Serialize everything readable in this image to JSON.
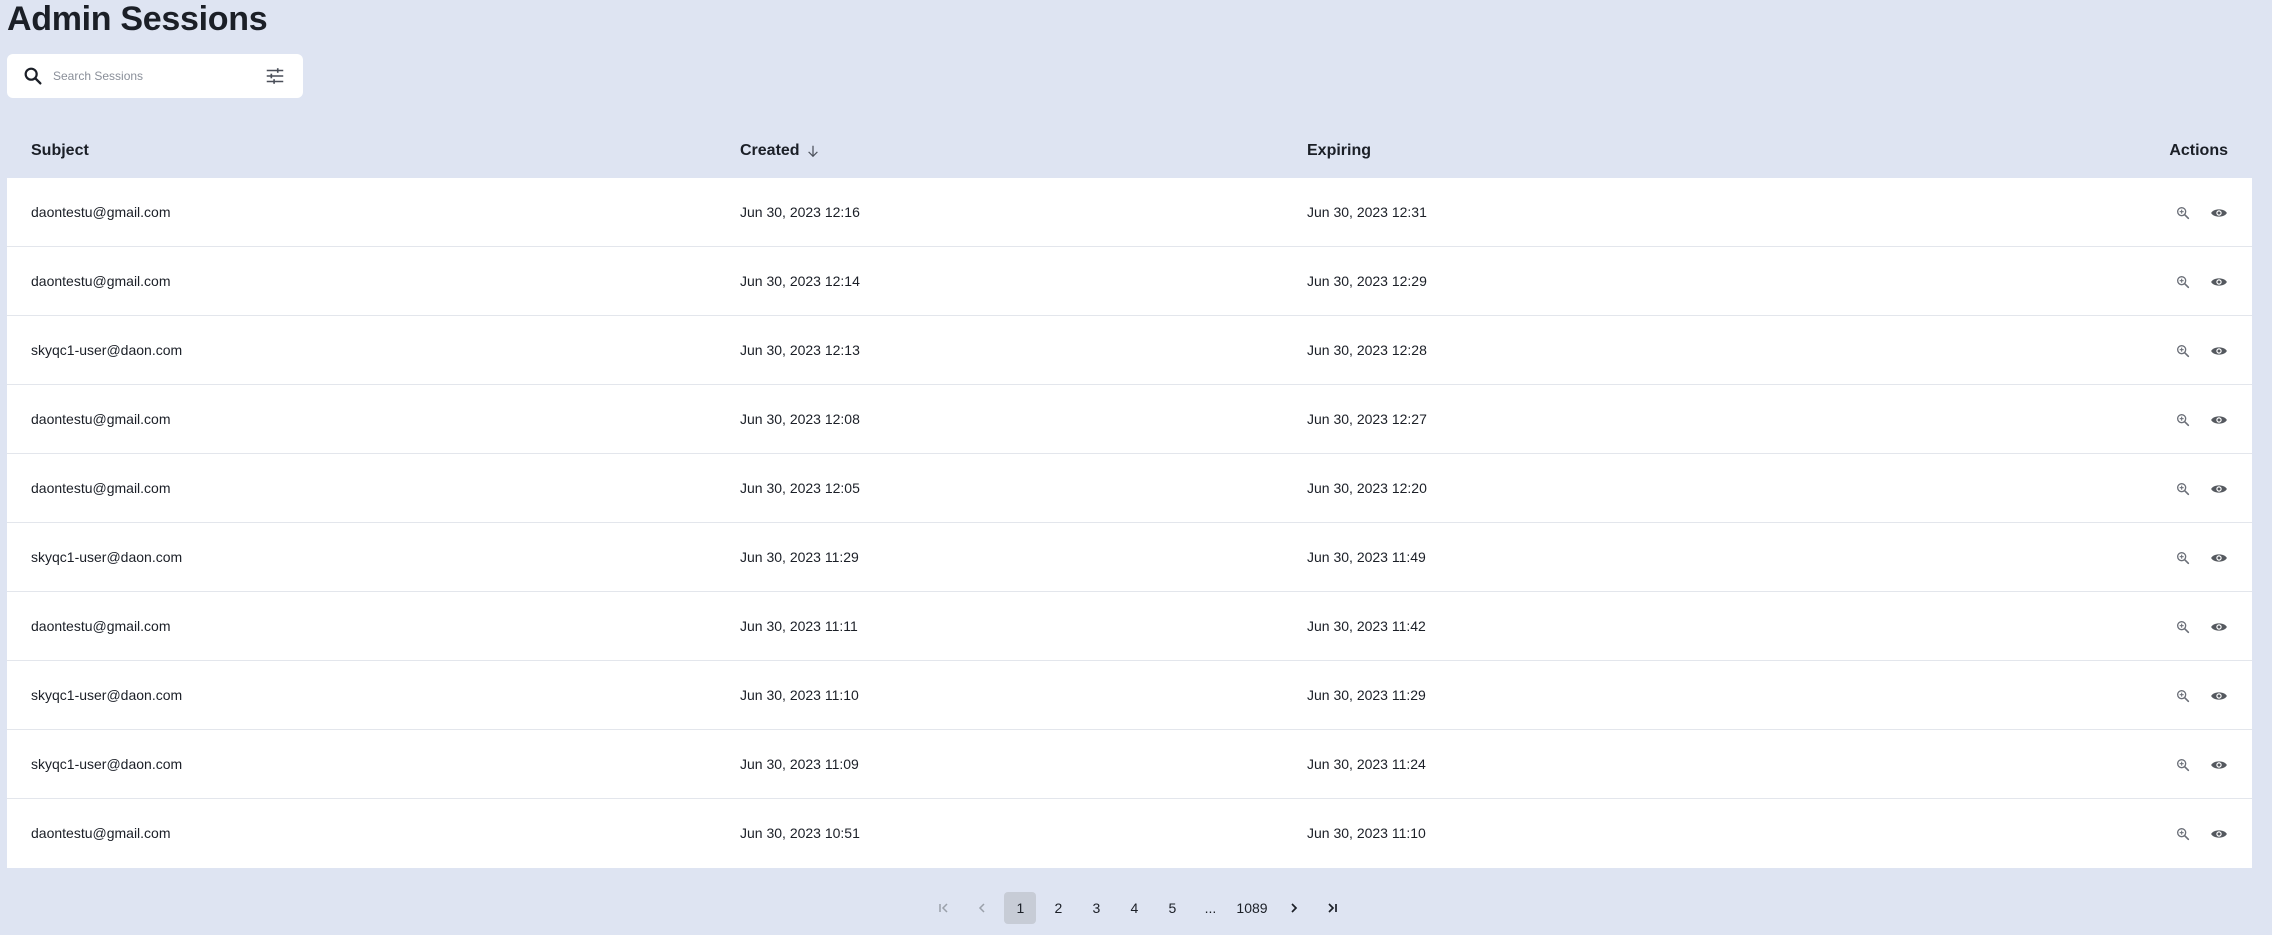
{
  "page": {
    "title": "Admin Sessions"
  },
  "search": {
    "placeholder": "Search Sessions",
    "value": ""
  },
  "table": {
    "columns": {
      "subject": "Subject",
      "created": "Created",
      "expiring": "Expiring",
      "actions": "Actions"
    },
    "rows": [
      {
        "subject": "daontestu@gmail.com",
        "created": "Jun 30, 2023 12:16",
        "expiring": "Jun 30, 2023 12:31"
      },
      {
        "subject": "daontestu@gmail.com",
        "created": "Jun 30, 2023 12:14",
        "expiring": "Jun 30, 2023 12:29"
      },
      {
        "subject": "skyqc1-user@daon.com",
        "created": "Jun 30, 2023 12:13",
        "expiring": "Jun 30, 2023 12:28"
      },
      {
        "subject": "daontestu@gmail.com",
        "created": "Jun 30, 2023 12:08",
        "expiring": "Jun 30, 2023 12:27"
      },
      {
        "subject": "daontestu@gmail.com",
        "created": "Jun 30, 2023 12:05",
        "expiring": "Jun 30, 2023 12:20"
      },
      {
        "subject": "skyqc1-user@daon.com",
        "created": "Jun 30, 2023 11:29",
        "expiring": "Jun 30, 2023 11:49"
      },
      {
        "subject": "daontestu@gmail.com",
        "created": "Jun 30, 2023 11:11",
        "expiring": "Jun 30, 2023 11:42"
      },
      {
        "subject": "skyqc1-user@daon.com",
        "created": "Jun 30, 2023 11:10",
        "expiring": "Jun 30, 2023 11:29"
      },
      {
        "subject": "skyqc1-user@daon.com",
        "created": "Jun 30, 2023 11:09",
        "expiring": "Jun 30, 2023 11:24"
      },
      {
        "subject": "daontestu@gmail.com",
        "created": "Jun 30, 2023 10:51",
        "expiring": "Jun 30, 2023 11:10"
      }
    ],
    "row_actions": [
      "zoom-in-icon",
      "eye-icon"
    ],
    "sort_icon": "arrow-down-icon"
  },
  "pagination": {
    "pages": [
      "1",
      "2",
      "3",
      "4",
      "5"
    ],
    "current": "1",
    "ellipsis": "...",
    "last_page": "1089",
    "icons": [
      "first-page-icon",
      "prev-page-icon",
      "next-page-icon",
      "last-page-icon"
    ]
  },
  "colors": {
    "background": "#dee4f2",
    "surface": "#ffffff",
    "active_page": "#c7ccd6",
    "text": "#1b1f27",
    "icon": "#6b6f78"
  }
}
